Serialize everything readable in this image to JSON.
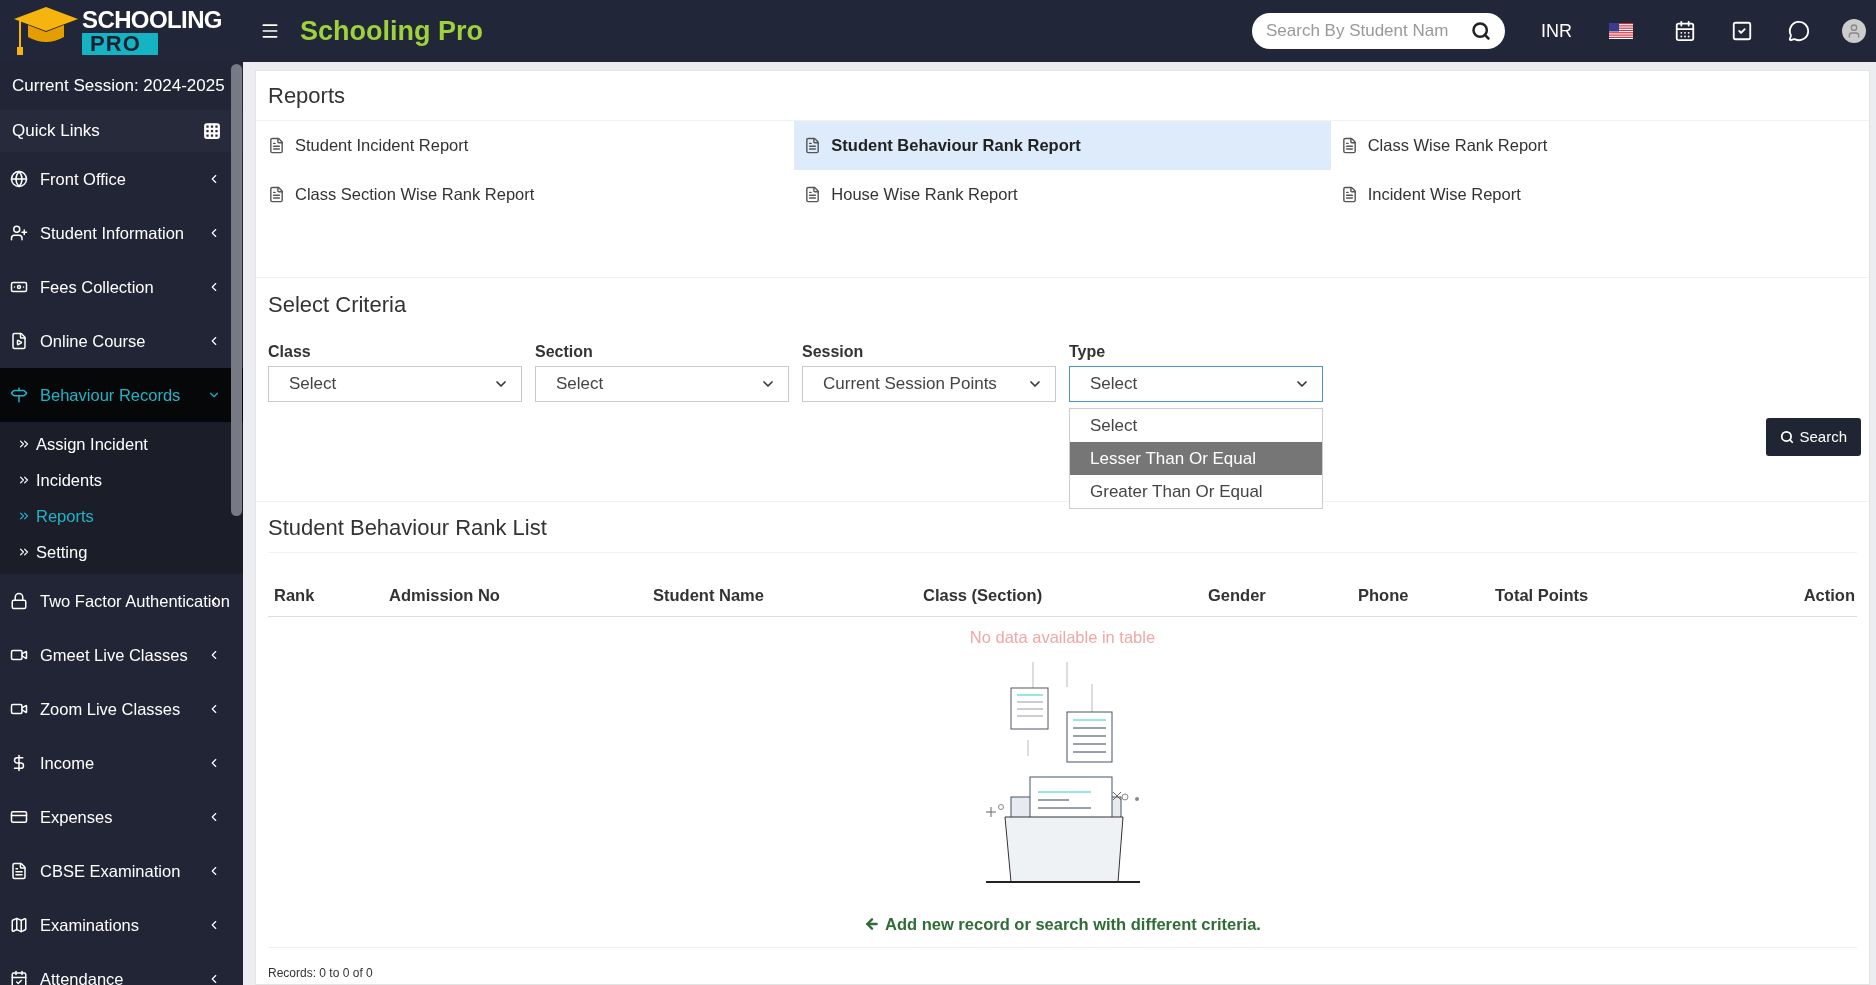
{
  "logo": {
    "line1": "SCHOOLING",
    "line2": "PRO"
  },
  "header": {
    "title": "Schooling Pro",
    "search": {
      "placeholder": "Search By Student Nam"
    },
    "currency": "INR"
  },
  "sidebar": {
    "session": "Current Session: 2024-2025",
    "quick_links": "Quick Links",
    "items": [
      {
        "label": "Front Office",
        "selected": false,
        "expanded": false
      },
      {
        "label": "Student Information",
        "selected": false,
        "expanded": false
      },
      {
        "label": "Fees Collection",
        "selected": false,
        "expanded": false
      },
      {
        "label": "Online Course",
        "selected": false,
        "expanded": false
      },
      {
        "label": "Behaviour Records",
        "selected": true,
        "expanded": true,
        "children": [
          {
            "label": "Assign Incident",
            "selected": false
          },
          {
            "label": "Incidents",
            "selected": false
          },
          {
            "label": "Reports",
            "selected": true
          },
          {
            "label": "Setting",
            "selected": false
          }
        ]
      },
      {
        "label": "Two Factor Authentication",
        "selected": false,
        "expanded": false
      },
      {
        "label": "Gmeet Live Classes",
        "selected": false,
        "expanded": false
      },
      {
        "label": "Zoom Live Classes",
        "selected": false,
        "expanded": false
      },
      {
        "label": "Income",
        "selected": false,
        "expanded": false
      },
      {
        "label": "Expenses",
        "selected": false,
        "expanded": false
      },
      {
        "label": "CBSE Examination",
        "selected": false,
        "expanded": false
      },
      {
        "label": "Examinations",
        "selected": false,
        "expanded": false
      },
      {
        "label": "Attendance",
        "selected": false,
        "expanded": false
      }
    ]
  },
  "reports": {
    "title": "Reports",
    "links": [
      {
        "label": "Student Incident Report",
        "selected": false
      },
      {
        "label": "Student Behaviour Rank Report",
        "selected": true
      },
      {
        "label": "Class Wise Rank Report",
        "selected": false
      },
      {
        "label": "Class Section Wise Rank Report",
        "selected": false
      },
      {
        "label": "House Wise Rank Report",
        "selected": false
      },
      {
        "label": "Incident Wise Report",
        "selected": false
      }
    ]
  },
  "criteria": {
    "title": "Select Criteria",
    "fields": [
      {
        "label": "Class",
        "value": "Select",
        "open": false
      },
      {
        "label": "Section",
        "value": "Select",
        "open": false
      },
      {
        "label": "Session",
        "value": "Current Session Points",
        "open": false
      },
      {
        "label": "Type",
        "value": "Select",
        "open": true,
        "options": [
          {
            "label": "Select",
            "highlighted": false
          },
          {
            "label": "Lesser Than Or Equal",
            "highlighted": true
          },
          {
            "label": "Greater Than Or Equal",
            "highlighted": false
          }
        ]
      }
    ],
    "search_button": "Search"
  },
  "rank_list": {
    "title": "Student Behaviour Rank List",
    "columns": [
      "Rank",
      "Admission No",
      "Student Name",
      "Class (Section)",
      "Gender",
      "Phone",
      "Total Points",
      "Action"
    ],
    "empty": "No data available in table",
    "hint": "Add new record or search with different criteria.",
    "records": "Records: 0 to 0 of 0"
  }
}
